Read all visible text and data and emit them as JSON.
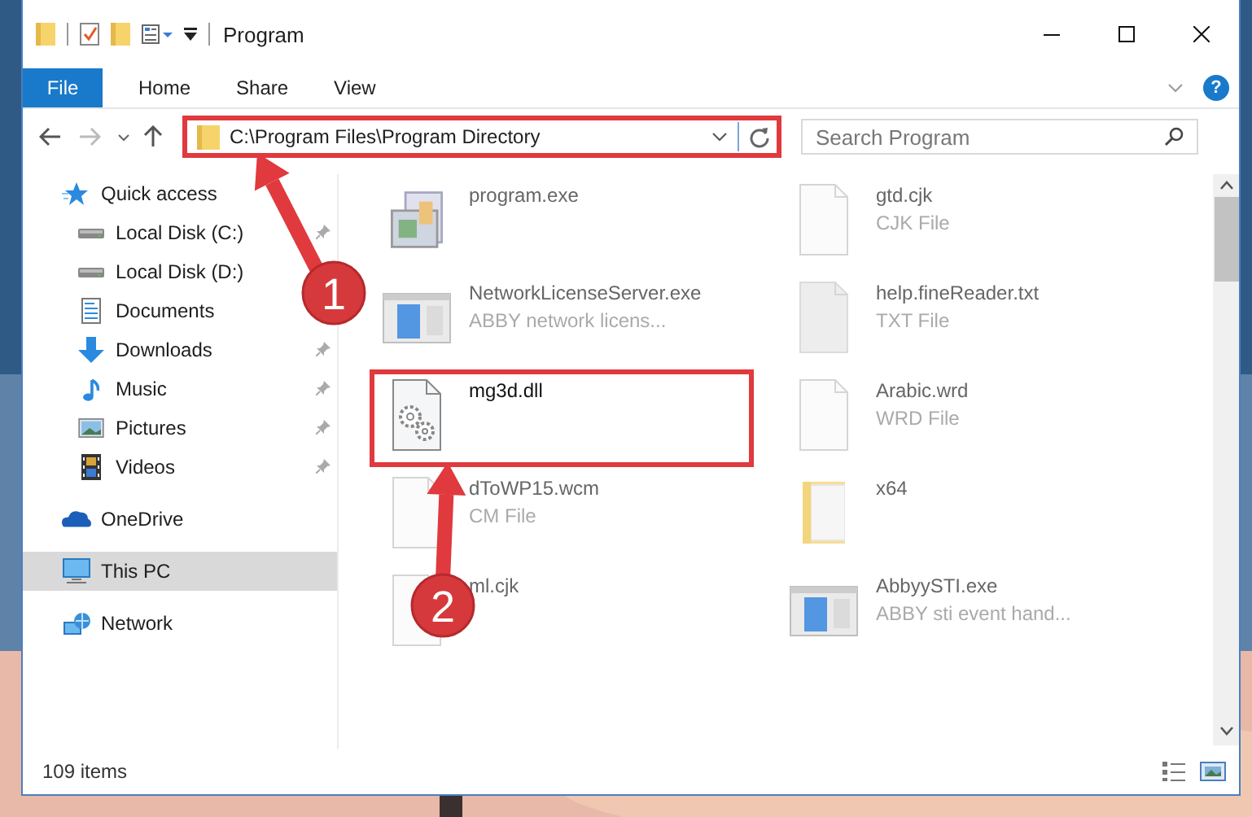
{
  "window": {
    "title": "Program"
  },
  "ribbon_tabs": [
    {
      "label": "File",
      "kind": "menu"
    },
    {
      "label": "Home",
      "kind": "tab"
    },
    {
      "label": "Share",
      "kind": "tab"
    },
    {
      "label": "View",
      "kind": "tab"
    }
  ],
  "help_button": {
    "label": "?"
  },
  "address_bar": {
    "path": "C:\\Program Files\\Program Directory",
    "highlighted": true
  },
  "search": {
    "placeholder": "Search Program"
  },
  "nav": [
    {
      "label": "Quick access",
      "kind": "star",
      "selected": false,
      "children": [
        {
          "label": "Local Disk (C:)",
          "kind": "drive",
          "pinned": true,
          "selected": false
        },
        {
          "label": "Local Disk (D:)",
          "kind": "drive",
          "pinned": false,
          "selected": false
        },
        {
          "label": "Documents",
          "kind": "documents",
          "pinned": false,
          "selected": false
        },
        {
          "label": "Downloads",
          "kind": "downloads",
          "pinned": true,
          "selected": false
        },
        {
          "label": "Music",
          "kind": "music",
          "pinned": true,
          "selected": false
        },
        {
          "label": "Pictures",
          "kind": "pictures",
          "pinned": true,
          "selected": false
        },
        {
          "label": "Videos",
          "kind": "videos",
          "pinned": true,
          "selected": false
        }
      ]
    },
    {
      "label": "OneDrive",
      "kind": "cloud",
      "selected": false
    },
    {
      "label": "This PC",
      "kind": "pc",
      "selected": true
    },
    {
      "label": "Network",
      "kind": "network",
      "selected": false
    }
  ],
  "files": [
    {
      "name": "program.exe",
      "kind": "app",
      "blurred": true,
      "highlighted": false
    },
    {
      "name": "gtd.cjk",
      "type": "CJK File",
      "kind": "blank",
      "blurred": true,
      "highlighted": false
    },
    {
      "name": "NetworkLicenseServer.exe",
      "type": "ABBY network licens...",
      "kind": "window",
      "blurred": true,
      "highlighted": false
    },
    {
      "name": "help.fineReader.txt",
      "type": "TXT File",
      "kind": "shaded",
      "blurred": true,
      "highlighted": false
    },
    {
      "name": "mg3d.dll",
      "kind": "dll",
      "blurred": false,
      "highlighted": true
    },
    {
      "name": "Arabic.wrd",
      "type": "WRD File",
      "kind": "blank",
      "blurred": true,
      "highlighted": false
    },
    {
      "name": "dToWP15.wcm",
      "type": "CM File",
      "kind": "blank",
      "blurred": true,
      "highlighted": false
    },
    {
      "name": "x64",
      "kind": "folder",
      "blurred": true,
      "highlighted": false
    },
    {
      "name": "ml.cjk",
      "kind": "blank",
      "blurred": true,
      "highlighted": false
    },
    {
      "name": "AbbyySTI.exe",
      "type": "ABBY sti event hand...",
      "kind": "window",
      "blurred": true,
      "highlighted": false
    }
  ],
  "callouts": [
    {
      "number": "1"
    },
    {
      "number": "2"
    }
  ],
  "status_bar": {
    "count": "109 items"
  }
}
